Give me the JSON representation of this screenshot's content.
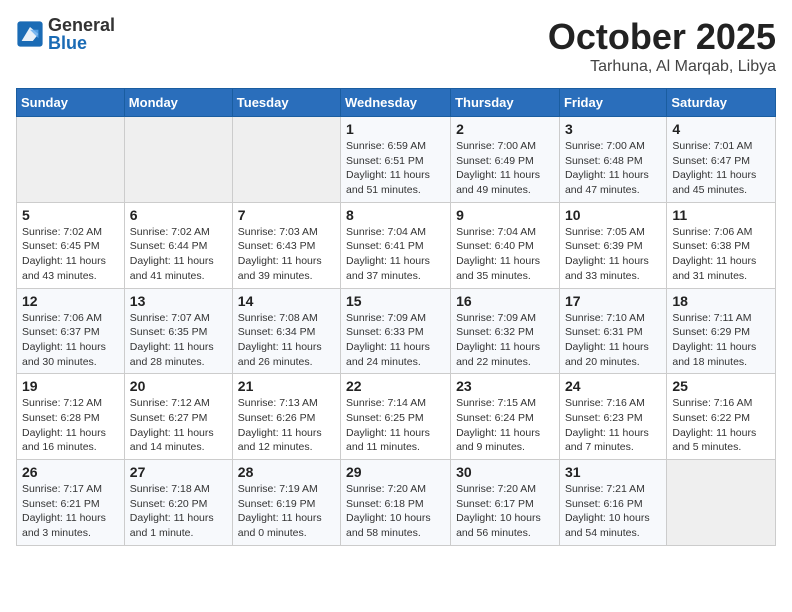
{
  "header": {
    "logo": {
      "general": "General",
      "blue": "Blue"
    },
    "title": "October 2025",
    "location": "Tarhuna, Al Marqab, Libya"
  },
  "weekdays": [
    "Sunday",
    "Monday",
    "Tuesday",
    "Wednesday",
    "Thursday",
    "Friday",
    "Saturday"
  ],
  "weeks": [
    [
      {
        "day": "",
        "empty": true
      },
      {
        "day": "",
        "empty": true
      },
      {
        "day": "",
        "empty": true
      },
      {
        "day": "1",
        "sunrise": "Sunrise: 6:59 AM",
        "sunset": "Sunset: 6:51 PM",
        "daylight": "Daylight: 11 hours and 51 minutes."
      },
      {
        "day": "2",
        "sunrise": "Sunrise: 7:00 AM",
        "sunset": "Sunset: 6:49 PM",
        "daylight": "Daylight: 11 hours and 49 minutes."
      },
      {
        "day": "3",
        "sunrise": "Sunrise: 7:00 AM",
        "sunset": "Sunset: 6:48 PM",
        "daylight": "Daylight: 11 hours and 47 minutes."
      },
      {
        "day": "4",
        "sunrise": "Sunrise: 7:01 AM",
        "sunset": "Sunset: 6:47 PM",
        "daylight": "Daylight: 11 hours and 45 minutes."
      }
    ],
    [
      {
        "day": "5",
        "sunrise": "Sunrise: 7:02 AM",
        "sunset": "Sunset: 6:45 PM",
        "daylight": "Daylight: 11 hours and 43 minutes."
      },
      {
        "day": "6",
        "sunrise": "Sunrise: 7:02 AM",
        "sunset": "Sunset: 6:44 PM",
        "daylight": "Daylight: 11 hours and 41 minutes."
      },
      {
        "day": "7",
        "sunrise": "Sunrise: 7:03 AM",
        "sunset": "Sunset: 6:43 PM",
        "daylight": "Daylight: 11 hours and 39 minutes."
      },
      {
        "day": "8",
        "sunrise": "Sunrise: 7:04 AM",
        "sunset": "Sunset: 6:41 PM",
        "daylight": "Daylight: 11 hours and 37 minutes."
      },
      {
        "day": "9",
        "sunrise": "Sunrise: 7:04 AM",
        "sunset": "Sunset: 6:40 PM",
        "daylight": "Daylight: 11 hours and 35 minutes."
      },
      {
        "day": "10",
        "sunrise": "Sunrise: 7:05 AM",
        "sunset": "Sunset: 6:39 PM",
        "daylight": "Daylight: 11 hours and 33 minutes."
      },
      {
        "day": "11",
        "sunrise": "Sunrise: 7:06 AM",
        "sunset": "Sunset: 6:38 PM",
        "daylight": "Daylight: 11 hours and 31 minutes."
      }
    ],
    [
      {
        "day": "12",
        "sunrise": "Sunrise: 7:06 AM",
        "sunset": "Sunset: 6:37 PM",
        "daylight": "Daylight: 11 hours and 30 minutes."
      },
      {
        "day": "13",
        "sunrise": "Sunrise: 7:07 AM",
        "sunset": "Sunset: 6:35 PM",
        "daylight": "Daylight: 11 hours and 28 minutes."
      },
      {
        "day": "14",
        "sunrise": "Sunrise: 7:08 AM",
        "sunset": "Sunset: 6:34 PM",
        "daylight": "Daylight: 11 hours and 26 minutes."
      },
      {
        "day": "15",
        "sunrise": "Sunrise: 7:09 AM",
        "sunset": "Sunset: 6:33 PM",
        "daylight": "Daylight: 11 hours and 24 minutes."
      },
      {
        "day": "16",
        "sunrise": "Sunrise: 7:09 AM",
        "sunset": "Sunset: 6:32 PM",
        "daylight": "Daylight: 11 hours and 22 minutes."
      },
      {
        "day": "17",
        "sunrise": "Sunrise: 7:10 AM",
        "sunset": "Sunset: 6:31 PM",
        "daylight": "Daylight: 11 hours and 20 minutes."
      },
      {
        "day": "18",
        "sunrise": "Sunrise: 7:11 AM",
        "sunset": "Sunset: 6:29 PM",
        "daylight": "Daylight: 11 hours and 18 minutes."
      }
    ],
    [
      {
        "day": "19",
        "sunrise": "Sunrise: 7:12 AM",
        "sunset": "Sunset: 6:28 PM",
        "daylight": "Daylight: 11 hours and 16 minutes."
      },
      {
        "day": "20",
        "sunrise": "Sunrise: 7:12 AM",
        "sunset": "Sunset: 6:27 PM",
        "daylight": "Daylight: 11 hours and 14 minutes."
      },
      {
        "day": "21",
        "sunrise": "Sunrise: 7:13 AM",
        "sunset": "Sunset: 6:26 PM",
        "daylight": "Daylight: 11 hours and 12 minutes."
      },
      {
        "day": "22",
        "sunrise": "Sunrise: 7:14 AM",
        "sunset": "Sunset: 6:25 PM",
        "daylight": "Daylight: 11 hours and 11 minutes."
      },
      {
        "day": "23",
        "sunrise": "Sunrise: 7:15 AM",
        "sunset": "Sunset: 6:24 PM",
        "daylight": "Daylight: 11 hours and 9 minutes."
      },
      {
        "day": "24",
        "sunrise": "Sunrise: 7:16 AM",
        "sunset": "Sunset: 6:23 PM",
        "daylight": "Daylight: 11 hours and 7 minutes."
      },
      {
        "day": "25",
        "sunrise": "Sunrise: 7:16 AM",
        "sunset": "Sunset: 6:22 PM",
        "daylight": "Daylight: 11 hours and 5 minutes."
      }
    ],
    [
      {
        "day": "26",
        "sunrise": "Sunrise: 7:17 AM",
        "sunset": "Sunset: 6:21 PM",
        "daylight": "Daylight: 11 hours and 3 minutes."
      },
      {
        "day": "27",
        "sunrise": "Sunrise: 7:18 AM",
        "sunset": "Sunset: 6:20 PM",
        "daylight": "Daylight: 11 hours and 1 minute."
      },
      {
        "day": "28",
        "sunrise": "Sunrise: 7:19 AM",
        "sunset": "Sunset: 6:19 PM",
        "daylight": "Daylight: 11 hours and 0 minutes."
      },
      {
        "day": "29",
        "sunrise": "Sunrise: 7:20 AM",
        "sunset": "Sunset: 6:18 PM",
        "daylight": "Daylight: 10 hours and 58 minutes."
      },
      {
        "day": "30",
        "sunrise": "Sunrise: 7:20 AM",
        "sunset": "Sunset: 6:17 PM",
        "daylight": "Daylight: 10 hours and 56 minutes."
      },
      {
        "day": "31",
        "sunrise": "Sunrise: 7:21 AM",
        "sunset": "Sunset: 6:16 PM",
        "daylight": "Daylight: 10 hours and 54 minutes."
      },
      {
        "day": "",
        "empty": true
      }
    ]
  ]
}
